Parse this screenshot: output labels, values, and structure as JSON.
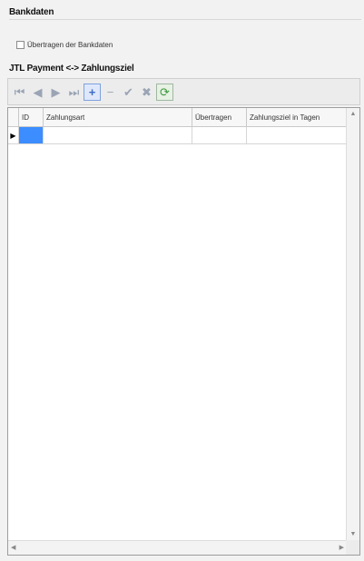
{
  "bankdaten": {
    "title": "Bankdaten",
    "checkbox_label": "Übertragen der Bankdaten",
    "checkbox_checked": false
  },
  "grid": {
    "title": "JTL Payment <-> Zahlungsziel",
    "toolbar": {
      "buttons": [
        {
          "name": "first-record",
          "glyph": "⏮"
        },
        {
          "name": "previous-record",
          "glyph": "◀"
        },
        {
          "name": "next-record",
          "glyph": "▶"
        },
        {
          "name": "last-record",
          "glyph": "⏭"
        },
        {
          "name": "add-record",
          "glyph": "+"
        },
        {
          "name": "delete-record",
          "glyph": "−"
        },
        {
          "name": "confirm-edit",
          "glyph": "✔"
        },
        {
          "name": "cancel-edit",
          "glyph": "✖"
        },
        {
          "name": "refresh",
          "glyph": "⟳"
        }
      ]
    },
    "columns": [
      "ID",
      "Zahlungsart",
      "Übertragen",
      "Zahlungsziel in Tagen"
    ],
    "row_indicator": "▶",
    "rows": [
      {
        "id": "",
        "zahlungsart": "",
        "uebertragen": "",
        "ziel": ""
      }
    ],
    "selection_color": "#3c8dff",
    "scroll_up": "▲",
    "scroll_down": "▼",
    "scroll_left": "◀",
    "scroll_right": "▶"
  }
}
